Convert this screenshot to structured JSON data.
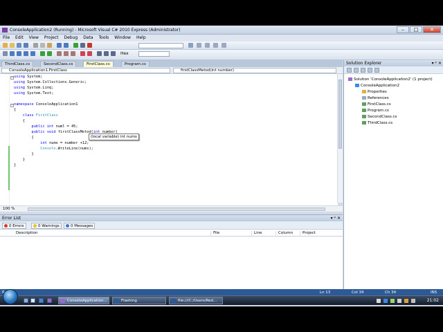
{
  "window": {
    "title": "ConsoleApplication2 (Running) - Microsoft Visual C# 2010 Express (Administrator)",
    "buttons": {
      "min": "–",
      "max": "□",
      "close": "✕"
    }
  },
  "menu": [
    "File",
    "Edit",
    "View",
    "Project",
    "Debug",
    "Data",
    "Tools",
    "Window",
    "Help"
  ],
  "toolbar": {
    "hex_label": "Hex"
  },
  "tabs": [
    {
      "label": "ThirdClass.cs",
      "active": false
    },
    {
      "label": "SecondClass.cs",
      "active": false
    },
    {
      "label": "FirstClass.cs",
      "active": true
    },
    {
      "label": "Program.cs",
      "active": false
    }
  ],
  "navbar": {
    "type_combo": "ConsoleApplication1.FirstClass",
    "member_combo": "firstClassMetod(int number)"
  },
  "code": {
    "lines": [
      {
        "indent": "",
        "parts": [
          [
            "kw",
            "using"
          ],
          [
            "",
            "System;"
          ]
        ]
      },
      {
        "indent": "",
        "parts": [
          [
            "kw",
            "using"
          ],
          [
            "",
            "System.Collections.Generic;"
          ]
        ]
      },
      {
        "indent": "",
        "parts": [
          [
            "kw",
            "using"
          ],
          [
            "",
            "System.Linq;"
          ]
        ]
      },
      {
        "indent": "",
        "parts": [
          [
            "kw",
            "using"
          ],
          [
            "",
            "System.Text;"
          ]
        ]
      },
      {
        "indent": "",
        "parts": []
      },
      {
        "indent": "",
        "parts": [
          [
            "kw",
            "namespace"
          ],
          [
            "",
            "ConsoleApplication1"
          ]
        ]
      },
      {
        "indent": "",
        "parts": [
          [
            "",
            "{"
          ]
        ]
      },
      {
        "indent": "    ",
        "parts": [
          [
            "kw",
            "class"
          ],
          [
            "ty",
            "FirstClass"
          ]
        ]
      },
      {
        "indent": "    ",
        "parts": [
          [
            "",
            "{"
          ]
        ]
      },
      {
        "indent": "        ",
        "parts": [
          [
            "kw",
            "public"
          ],
          [
            "kw",
            "int"
          ],
          [
            "",
            "numl = 45;"
          ]
        ]
      },
      {
        "indent": "        ",
        "parts": [
          [
            "kw",
            "public"
          ],
          [
            "kw",
            "void"
          ],
          [
            "",
            "firstClassMetod("
          ],
          [
            "kw",
            "int"
          ],
          [
            "",
            "number)"
          ]
        ]
      },
      {
        "indent": "        ",
        "parts": [
          [
            "",
            "{"
          ]
        ]
      },
      {
        "indent": "            ",
        "parts": [
          [
            "kw",
            "int"
          ],
          [
            "",
            "nums = number +12;"
          ]
        ]
      },
      {
        "indent": "            ",
        "parts": [
          [
            "ty",
            "Console"
          ],
          [
            "",
            ".WriteLine(nums);"
          ]
        ]
      },
      {
        "indent": "        ",
        "parts": [
          [
            "",
            "}"
          ]
        ]
      },
      {
        "indent": "    ",
        "parts": [
          [
            "",
            "}"
          ]
        ]
      },
      {
        "indent": "",
        "parts": [
          [
            "",
            "}"
          ]
        ]
      }
    ],
    "tooltip": "(local variable) int nums",
    "zoom": "100 %"
  },
  "error_list": {
    "title": "Error List",
    "pane_buttons": "▾ ᵖ ✕",
    "filters": {
      "errors": "0 Errors",
      "warnings": "0 Warnings",
      "messages": "0 Messages"
    },
    "columns": [
      "Description",
      "File",
      "Line",
      "Column",
      "Project"
    ]
  },
  "solution_explorer": {
    "title": "Solution Explorer",
    "pane_buttons": "▾ ᵖ ✕",
    "items": [
      {
        "label": "Solution 'ConsoleApplication2' (1 project)",
        "level": 0
      },
      {
        "label": "ConsoleApplication2",
        "level": 1
      },
      {
        "label": "Properties",
        "level": 2
      },
      {
        "label": "References",
        "level": 2
      },
      {
        "label": "FirstClass.cs",
        "level": 2
      },
      {
        "label": "Program.cs",
        "level": 2
      },
      {
        "label": "SecondClass.cs",
        "level": 2
      },
      {
        "label": "ThirdClass.cs",
        "level": 2
      }
    ]
  },
  "status": {
    "ready": "Ready",
    "ln": "Ln 13",
    "col": "Col 34",
    "ch": "Ch 34",
    "ins": "INS"
  },
  "taskbar": {
    "tasks": [
      "ConsoleApplication...",
      "Flashing",
      "file:///C:/Users/Red..."
    ],
    "clock": "21:02"
  }
}
